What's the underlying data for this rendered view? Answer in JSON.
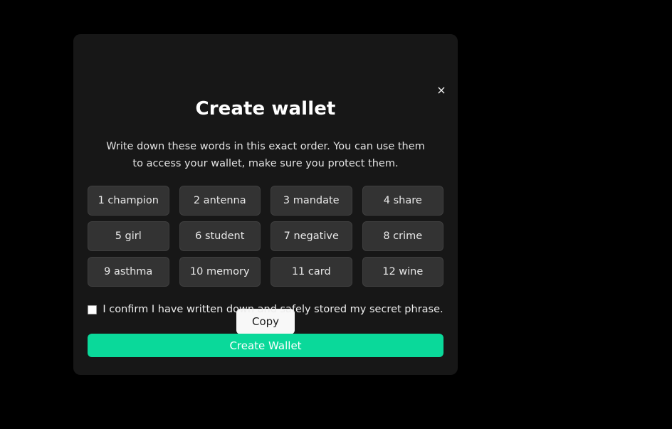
{
  "modal": {
    "title": "Create wallet",
    "description": "Write down these words in this exact order. You can use them to access your wallet, make sure you protect them.",
    "close_icon": "close-icon",
    "close_glyph": "×",
    "words": [
      {
        "index": "1",
        "word": "champion",
        "display": "1 champion"
      },
      {
        "index": "2",
        "word": "antenna",
        "display": "2 antenna"
      },
      {
        "index": "3",
        "word": "mandate",
        "display": "3 mandate"
      },
      {
        "index": "4",
        "word": "share",
        "display": "4 share"
      },
      {
        "index": "5",
        "word": "girl",
        "display": "5 girl"
      },
      {
        "index": "6",
        "word": "student",
        "display": "6 student"
      },
      {
        "index": "7",
        "word": "negative",
        "display": "7 negative"
      },
      {
        "index": "8",
        "word": "crime",
        "display": "8 crime"
      },
      {
        "index": "9",
        "word": "asthma",
        "display": "9 asthma"
      },
      {
        "index": "10",
        "word": "memory",
        "display": "10 memory"
      },
      {
        "index": "11",
        "word": "card",
        "display": "11 card"
      },
      {
        "index": "12",
        "word": "wine",
        "display": "12 wine"
      }
    ],
    "copy_label": "Copy",
    "confirm_label": "I confirm I have written down and safely stored my secret phrase.",
    "confirm_checked": false,
    "create_label": "Create Wallet"
  },
  "colors": {
    "page_background": "#000000",
    "modal_background": "#171717",
    "chip_background": "#333333",
    "chip_border": "#3f3f3f",
    "accent_green": "#0ad99a",
    "copy_button_background": "#f8f8f8",
    "title_text": "#ffffff",
    "body_text": "#e2e2e2"
  }
}
